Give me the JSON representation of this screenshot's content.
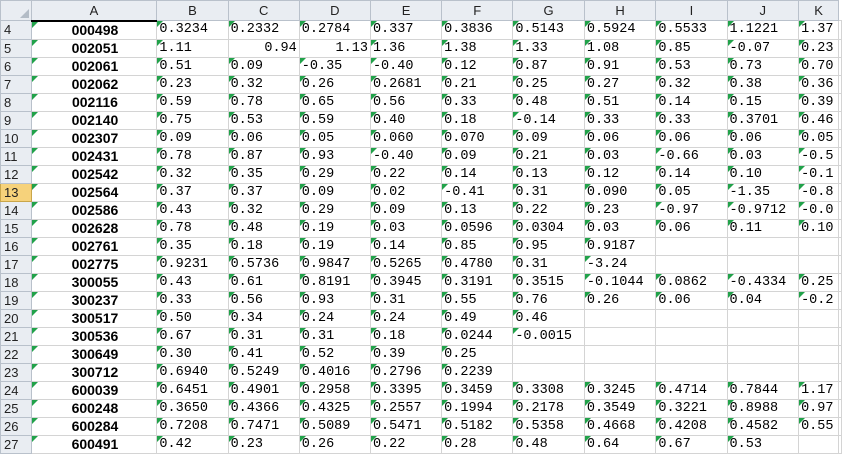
{
  "columns": [
    "A",
    "B",
    "C",
    "D",
    "E",
    "F",
    "G",
    "H",
    "I",
    "J",
    "K"
  ],
  "highlight_color": "#f6d27b",
  "error_flag_color": "#21a24a",
  "rows": [
    {
      "num": "4",
      "code": "000498",
      "vals": [
        "0.3234",
        "0.2332",
        "0.2784",
        "0.337",
        "0.3836",
        "0.5143",
        "0.5924",
        "0.5533",
        "1.1221",
        "1.37"
      ]
    },
    {
      "num": "5",
      "code": "002051",
      "vals": [
        "1.11",
        "0.94",
        "1.13",
        "1.36",
        "1.38",
        "1.33",
        "1.08",
        "0.85",
        "-0.07",
        "0.23"
      ]
    },
    {
      "num": "6",
      "code": "002061",
      "vals": [
        "0.51",
        "0.09",
        "-0.35",
        "-0.40",
        "0.12",
        "0.87",
        "0.91",
        "0.53",
        "0.73",
        "0.70"
      ]
    },
    {
      "num": "7",
      "code": "002062",
      "vals": [
        "0.23",
        "0.32",
        "0.26",
        "0.2681",
        "0.21",
        "0.25",
        "0.27",
        "0.32",
        "0.38",
        "0.36"
      ]
    },
    {
      "num": "8",
      "code": "002116",
      "vals": [
        "0.59",
        "0.78",
        "0.65",
        "0.56",
        "0.33",
        "0.48",
        "0.51",
        "0.14",
        "0.15",
        "0.39"
      ]
    },
    {
      "num": "9",
      "code": "002140",
      "vals": [
        "0.75",
        "0.53",
        "0.59",
        "0.40",
        "0.18",
        "-0.14",
        "0.33",
        "0.33",
        "0.3701",
        "0.46"
      ]
    },
    {
      "num": "10",
      "code": "002307",
      "vals": [
        "0.09",
        "0.06",
        "0.05",
        "0.060",
        "0.070",
        "0.09",
        "0.06",
        "0.06",
        "0.06",
        "0.05"
      ]
    },
    {
      "num": "11",
      "code": "002431",
      "vals": [
        "0.78",
        "0.87",
        "0.93",
        "-0.40",
        "0.09",
        "0.21",
        "0.03",
        "-0.66",
        "0.03",
        "-0.5"
      ]
    },
    {
      "num": "12",
      "code": "002542",
      "vals": [
        "0.32",
        "0.35",
        "0.29",
        "0.22",
        "0.14",
        "0.13",
        "0.12",
        "0.14",
        "0.10",
        "-0.1"
      ]
    },
    {
      "num": "13",
      "code": "002564",
      "vals": [
        "0.37",
        "0.37",
        "0.09",
        "0.02",
        "-0.41",
        "0.31",
        "0.090",
        "0.05",
        "-1.35",
        "-0.8"
      ]
    },
    {
      "num": "14",
      "code": "002586",
      "vals": [
        "0.43",
        "0.32",
        "0.29",
        "0.09",
        "0.13",
        "0.22",
        "0.23",
        "-0.97",
        "-0.9712",
        "-0.0"
      ]
    },
    {
      "num": "15",
      "code": "002628",
      "vals": [
        "0.78",
        "0.48",
        "0.19",
        "0.03",
        "0.0596",
        "0.0304",
        "0.03",
        "0.06",
        "0.11",
        "0.10"
      ]
    },
    {
      "num": "16",
      "code": "002761",
      "vals": [
        "0.35",
        "0.18",
        "0.19",
        "0.14",
        "0.85",
        "0.95",
        "0.9187",
        "",
        "",
        ""
      ]
    },
    {
      "num": "17",
      "code": "002775",
      "vals": [
        "0.9231",
        "0.5736",
        "0.9847",
        "0.5265",
        "0.4780",
        "0.31",
        "-3.24",
        "",
        "",
        ""
      ]
    },
    {
      "num": "18",
      "code": "300055",
      "vals": [
        "0.43",
        "0.61",
        "0.8191",
        "0.3945",
        "0.3191",
        "0.3515",
        "-0.1044",
        "0.0862",
        "-0.4334",
        "0.25"
      ]
    },
    {
      "num": "19",
      "code": "300237",
      "vals": [
        "0.33",
        "0.56",
        "0.93",
        "0.31",
        "0.55",
        "0.76",
        "0.26",
        "0.06",
        "0.04",
        "-0.2"
      ]
    },
    {
      "num": "20",
      "code": "300517",
      "vals": [
        "0.50",
        "0.34",
        "0.24",
        "0.24",
        "0.49",
        "0.46",
        "",
        "",
        "",
        ""
      ]
    },
    {
      "num": "21",
      "code": "300536",
      "vals": [
        "0.67",
        "0.31",
        "0.31",
        "0.18",
        "0.0244",
        "-0.0015",
        "",
        "",
        "",
        ""
      ]
    },
    {
      "num": "22",
      "code": "300649",
      "vals": [
        "0.30",
        "0.41",
        "0.52",
        "0.39",
        "0.25",
        "",
        "",
        "",
        "",
        ""
      ]
    },
    {
      "num": "23",
      "code": "300712",
      "vals": [
        "0.6940",
        "0.5249",
        "0.4016",
        "0.2796",
        "0.2239",
        "",
        "",
        "",
        "",
        ""
      ]
    },
    {
      "num": "24",
      "code": "600039",
      "vals": [
        "0.6451",
        "0.4901",
        "0.2958",
        "0.3395",
        "0.3459",
        "0.3308",
        "0.3245",
        "0.4714",
        "0.7844",
        "1.17"
      ]
    },
    {
      "num": "25",
      "code": "600248",
      "vals": [
        "0.3650",
        "0.4366",
        "0.4325",
        "0.2557",
        "0.1994",
        "0.2178",
        "0.3549",
        "0.3221",
        "0.8988",
        "0.97"
      ]
    },
    {
      "num": "26",
      "code": "600284",
      "vals": [
        "0.7208",
        "0.7471",
        "0.5089",
        "0.5471",
        "0.5182",
        "0.5358",
        "0.4668",
        "0.4208",
        "0.4582",
        "0.55"
      ]
    },
    {
      "num": "27",
      "code": "600491",
      "vals": [
        "0.42",
        "0.23",
        "0.26",
        "0.22",
        "0.28",
        "0.48",
        "0.64",
        "0.67",
        "0.53",
        ""
      ]
    }
  ]
}
